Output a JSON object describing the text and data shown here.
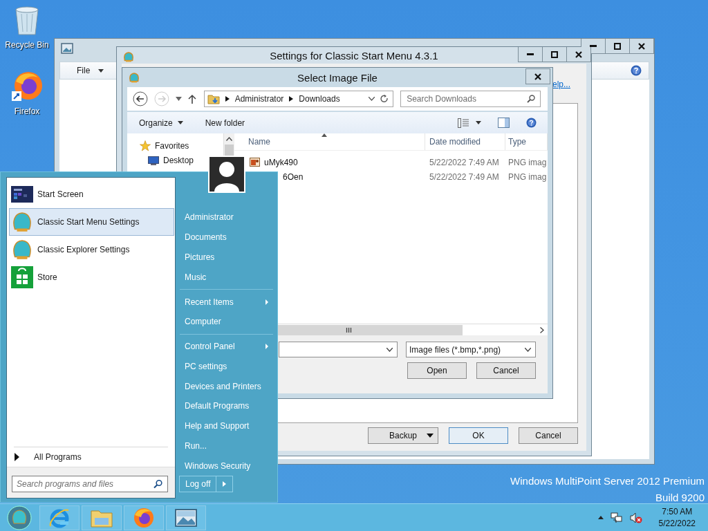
{
  "desktop_icons": [
    {
      "label": "Recycle Bin",
      "kind": "recycle"
    },
    {
      "label": "Firefox",
      "kind": "firefox"
    }
  ],
  "background_window": {
    "menu": [
      {
        "label": "File"
      }
    ]
  },
  "settings_window": {
    "title": "Settings for Classic Start Menu 4.3.1",
    "link": "elp...",
    "buttons": [
      {
        "label": "Backup",
        "kind": "split"
      },
      {
        "label": "OK",
        "kind": "default"
      },
      {
        "label": "Cancel",
        "kind": "plain"
      }
    ]
  },
  "file_dialog": {
    "title": "Select Image File",
    "breadcrumb": [
      "Administrator",
      "Downloads"
    ],
    "search": {
      "placeholder": "Search Downloads"
    },
    "toolbar": [
      {
        "label": "Organize",
        "kind": "menu"
      },
      {
        "label": "New folder",
        "kind": "plain"
      }
    ],
    "nav": [
      {
        "label": "Favorites",
        "kind": "star"
      },
      {
        "label": "Desktop",
        "kind": "desktop"
      }
    ],
    "columns": [
      "Name",
      "Date modified",
      "Type"
    ],
    "files": [
      {
        "name": "uMyk490",
        "date": "5/22/2022 7:49 AM",
        "type": "PNG imag"
      },
      {
        "name": "6Oen",
        "date": "5/22/2022 7:49 AM",
        "type": "PNG imag"
      }
    ],
    "file_type": "Image files (*.bmp,*.png)",
    "buttons": [
      "Open",
      "Cancel"
    ]
  },
  "start_menu": {
    "programs": [
      {
        "label": "Start Screen",
        "kind": "start",
        "selected": false
      },
      {
        "label": "Classic Start Menu Settings",
        "kind": "shell",
        "selected": true
      },
      {
        "label": "Classic Explorer Settings",
        "kind": "shell",
        "selected": false
      },
      {
        "label": "Store",
        "kind": "store",
        "selected": false
      }
    ],
    "all_programs": "All Programs",
    "search": {
      "placeholder": "Search programs and files"
    },
    "groups": [
      [
        {
          "label": "Administrator",
          "submenu": false
        },
        {
          "label": "Documents",
          "submenu": false
        },
        {
          "label": "Pictures",
          "submenu": false
        },
        {
          "label": "Music",
          "submenu": false
        }
      ],
      [
        {
          "label": "Recent Items",
          "submenu": true
        },
        {
          "label": "Computer",
          "submenu": false
        }
      ],
      [
        {
          "label": "Control Panel",
          "submenu": true
        },
        {
          "label": "PC settings",
          "submenu": false
        },
        {
          "label": "Devices and Printers",
          "submenu": false
        },
        {
          "label": "Default Programs",
          "submenu": false
        },
        {
          "label": "Help and Support",
          "submenu": false
        },
        {
          "label": "Run...",
          "submenu": false
        },
        {
          "label": "Windows Security",
          "submenu": false
        }
      ]
    ],
    "log_off": "Log off"
  },
  "branding": [
    "Windows MultiPoint Server 2012 Premium",
    "Build 9200"
  ],
  "taskbar": {
    "apps": [
      {
        "kind": "ie"
      },
      {
        "kind": "explorer"
      },
      {
        "kind": "firefox"
      },
      {
        "kind": "photos"
      }
    ],
    "clock": {
      "time": "7:50 AM",
      "date": "5/22/2022"
    }
  }
}
